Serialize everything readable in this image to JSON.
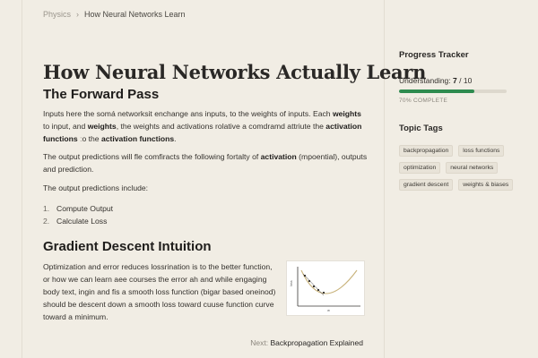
{
  "breadcrumb": {
    "parent": "Physics",
    "separator": "›",
    "current": "How Neural Networks Learn"
  },
  "page_title": "How Neural Networks Actually Learn",
  "section1": {
    "heading": "The Forward Pass",
    "p1": {
      "t1": "Inputs here the somá networksit enchange ans inputs, to the weights of inputs. Each ",
      "b1": "weights",
      "t2": " to input, and ",
      "b2": "weights",
      "t3": ", the weights and activations rolative a comdramd attriute the ",
      "b3": "activation functions",
      "t4": " ːo the ",
      "b4": "activation functions",
      "t5": "."
    },
    "p2": {
      "t1": "The output predictions will fle comfiracts the following fortalty of ",
      "b1": "activation",
      "t2": " (mpoential), outputs and prediction."
    },
    "p3": "The output predictions include:",
    "list": [
      {
        "num": "1.",
        "text": "Compute Output"
      },
      {
        "num": "2.",
        "text": "Calculate Loss"
      }
    ]
  },
  "section2": {
    "heading": "Gradient Descent Intuition",
    "para": "Optimization and error reduces lossrination is to the better function, or how we can learn aee courses the error ah and while engaging body text, ingin and fis a smooth loss function (bigar based oneinod) should be descent down a smooth loss toward cuuse function curve toward a minimum.",
    "figure": {
      "ylabel": "loss",
      "xlabel": "w",
      "curve_color": "#c8b27a",
      "point_color": "#2a2826"
    }
  },
  "next": {
    "label": "Next:",
    "title": "Backpropagation Explained"
  },
  "sidebar": {
    "progress": {
      "heading": "Progress Tracker",
      "label": "Understanding:",
      "value": "7",
      "total": "/ 10",
      "fraction": 0.7,
      "caption": "70% COMPLETE",
      "bar_color": "#2e8b4f"
    },
    "tags": {
      "heading": "Topic Tags",
      "items": [
        "backpropagation",
        "loss functions",
        "optimization",
        "neural networks",
        "gradient descent",
        "weights & biases"
      ]
    }
  }
}
